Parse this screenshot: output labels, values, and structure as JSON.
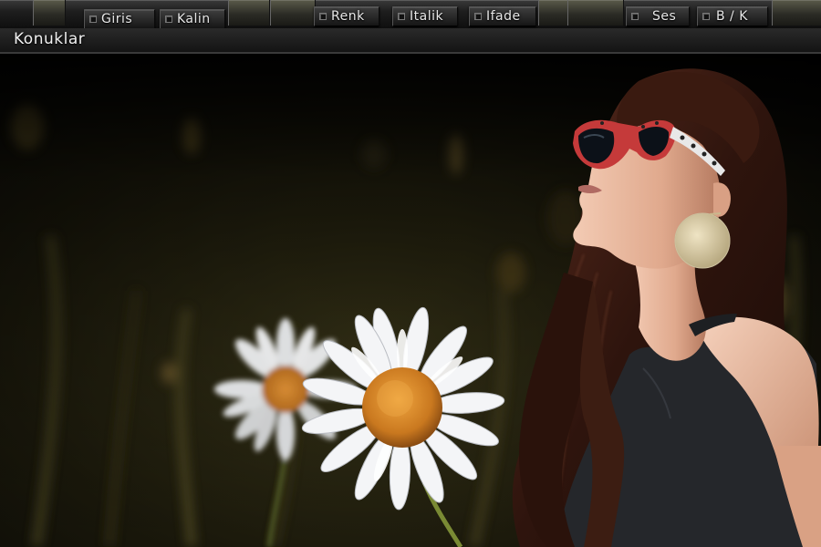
{
  "toolbar": {
    "buttons": [
      {
        "label": "Giris"
      },
      {
        "label": "Kalin"
      },
      {
        "label": "Renk"
      },
      {
        "label": "Italik"
      },
      {
        "label": "Ifade"
      },
      {
        "label": "Ses"
      },
      {
        "label": "B / K"
      }
    ]
  },
  "titlebar": {
    "title": "Konuklar"
  },
  "photo": {
    "description_icon": "photo-image",
    "colors": {
      "background_dark": "#0a0b06",
      "grass": "#3a3618",
      "petal": "#f2f4f6",
      "flower_center": "#d98a2a",
      "hair": "#3a1c14",
      "skin": "#e7b8a0",
      "top": "#2a2c30",
      "earring": "#d8cca8"
    }
  }
}
